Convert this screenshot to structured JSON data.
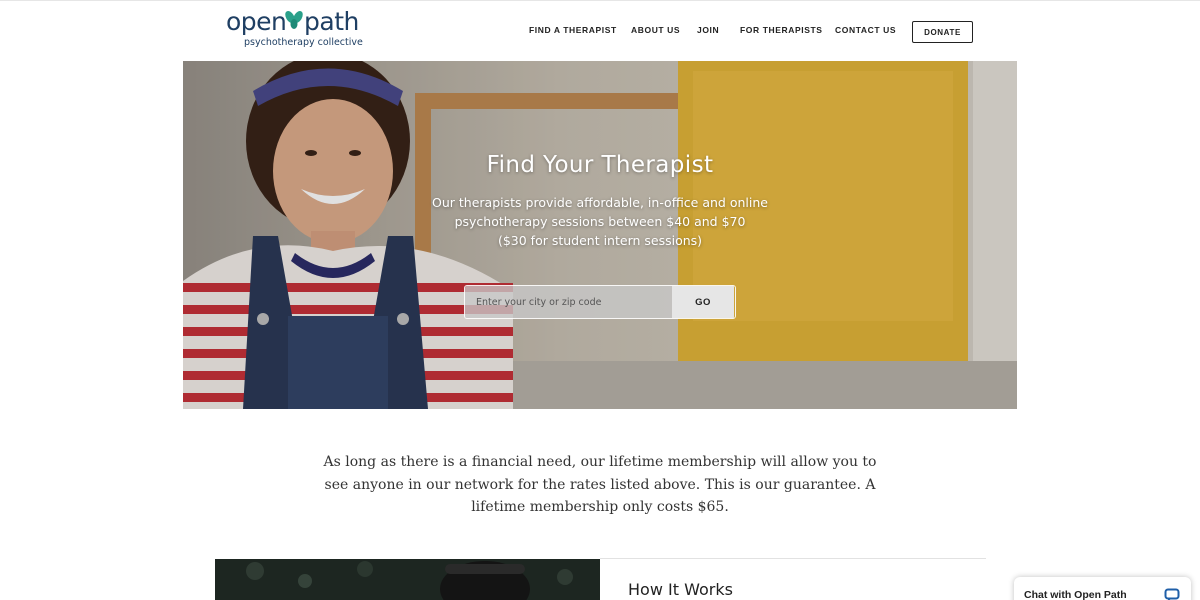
{
  "brand": {
    "name_open": "open",
    "name_path": "path",
    "tagline": "psychotherapy collective",
    "color": "#1f3f63",
    "leaf_color": "#2aa08a"
  },
  "nav": {
    "items": [
      "FIND A THERAPIST",
      "ABOUT US",
      "JOIN",
      "FOR THERAPISTS",
      "CONTACT US"
    ],
    "donate_label": "DONATE"
  },
  "hero": {
    "title": "Find Your Therapist",
    "subtitle_lines": [
      "Our therapists provide affordable, in-office and online",
      "psychotherapy sessions between $40 and $70",
      "($30 for student intern sessions)"
    ],
    "search_placeholder": "Enter your city or zip code",
    "go_label": "GO"
  },
  "guarantee": {
    "text": "As long as there is a financial need, our lifetime membership will allow you to see anyone in our network for the rates listed above. This is our guarantee. A lifetime membership only costs $65."
  },
  "how_it_works": {
    "title": "How It Works"
  },
  "chat": {
    "label": "Chat with Open Path",
    "icon": "chat-bubble-icon",
    "accent": "#1f5fa8"
  }
}
